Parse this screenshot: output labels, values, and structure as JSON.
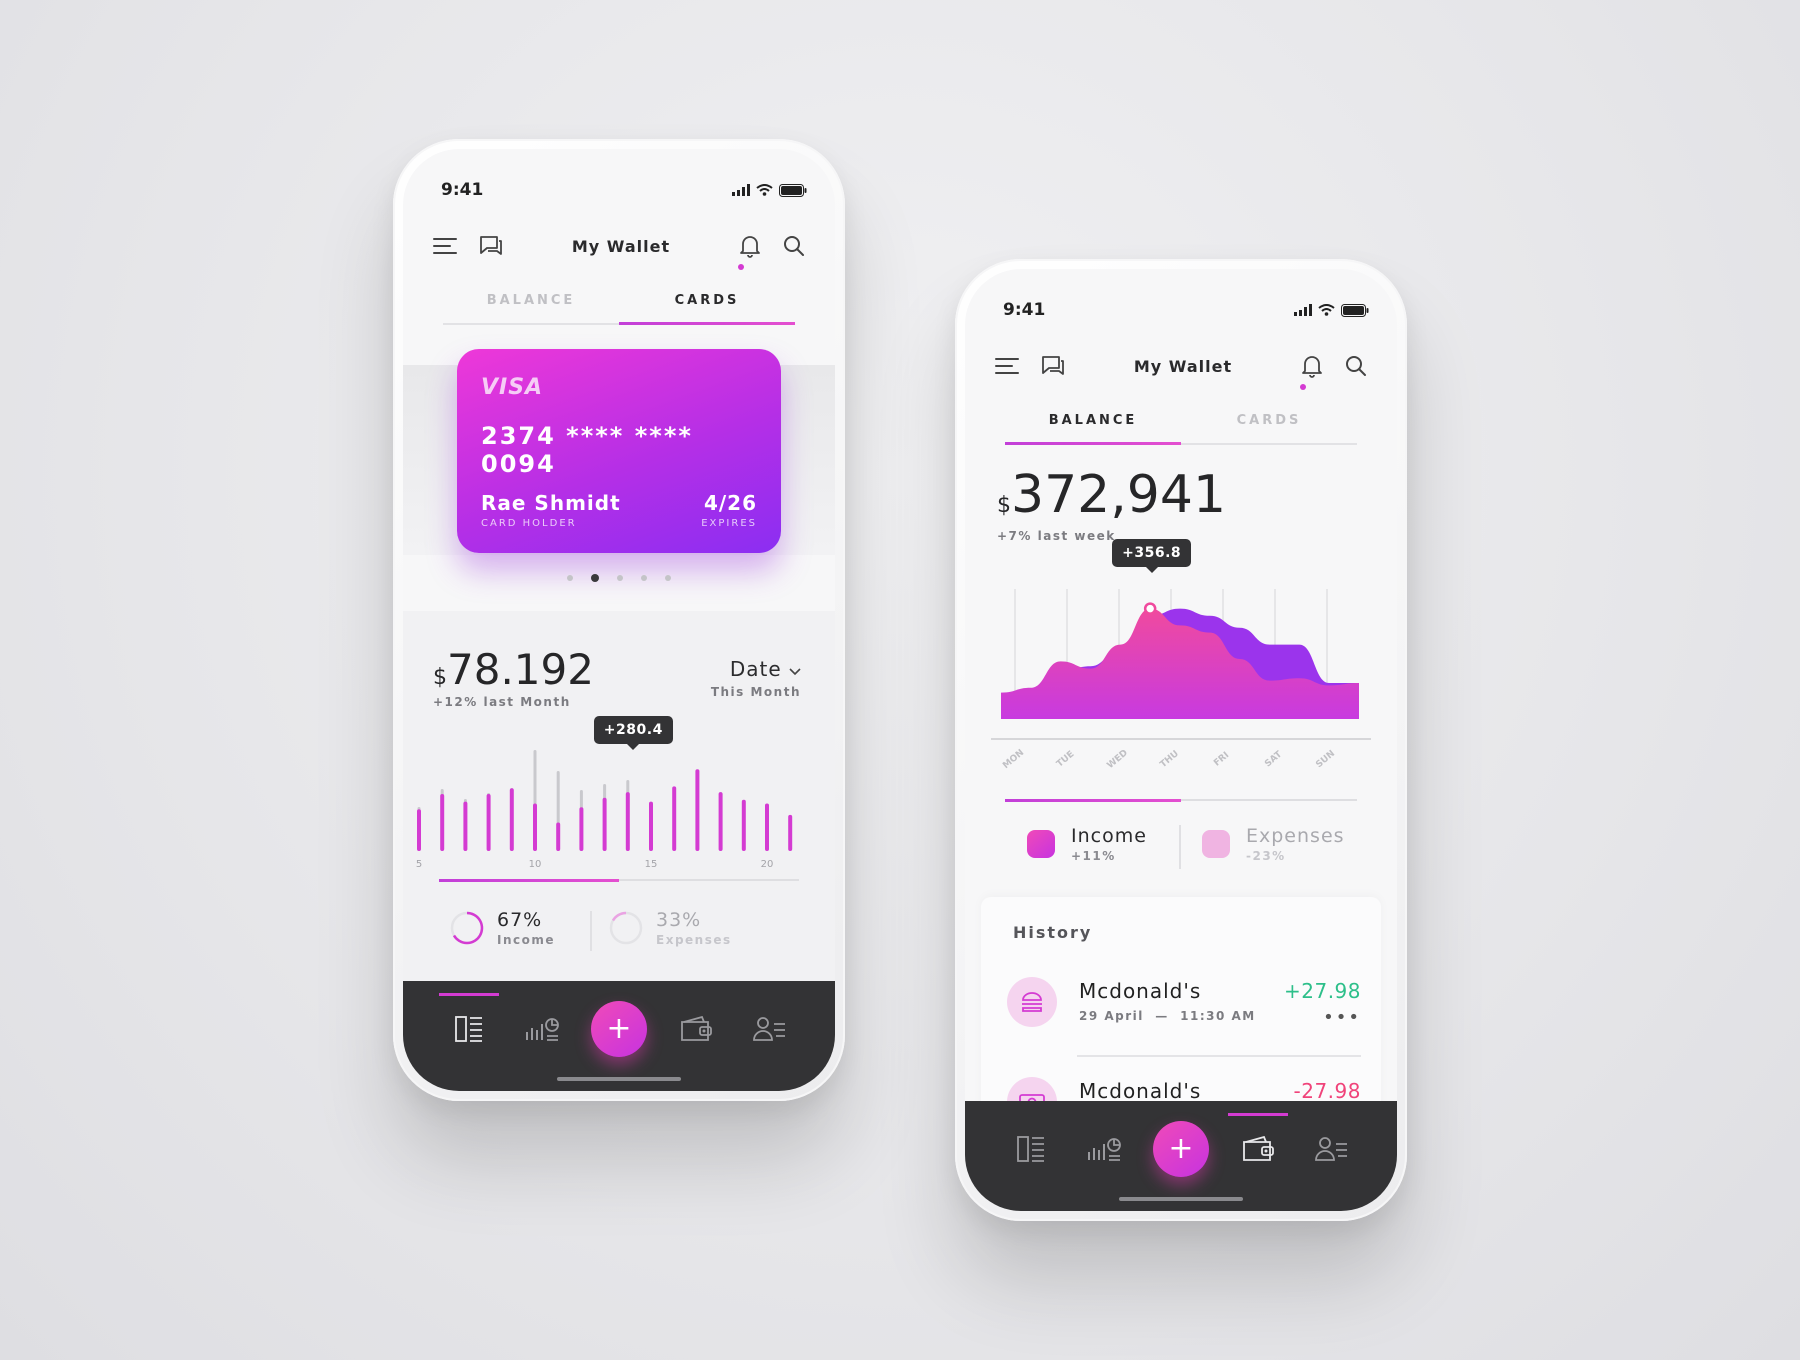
{
  "colors": {
    "accent": "#d43bd2",
    "accent_purple": "#8b2ef2",
    "income_green": "#2dbf8a",
    "expense_red": "#f0437a",
    "nav_bg": "#333335"
  },
  "left_phone": {
    "status_time": "9:41",
    "appbar": {
      "title": "My Wallet",
      "icons": [
        "menu-icon",
        "chat-icon",
        "bell-icon",
        "search-icon"
      ]
    },
    "tabs": [
      {
        "label": "BALANCE",
        "active": false
      },
      {
        "label": "CARDS",
        "active": true
      }
    ],
    "card": {
      "brand": "VISA",
      "number": "2374 **** **** 0094",
      "holder_name": "Rae Shmidt",
      "holder_label": "CARD HOLDER",
      "expiry": "4/26",
      "expiry_label": "EXPIRES",
      "pager_count": 5,
      "pager_active": 1
    },
    "summary": {
      "currency": "$",
      "amount": "78.192",
      "change": "+12% last Month",
      "date_label": "Date",
      "date_sub": "This Month"
    },
    "chart_data": {
      "type": "bar",
      "x": [
        5,
        6,
        7,
        8,
        9,
        10,
        11,
        12,
        13,
        14,
        15,
        16,
        17,
        18,
        19,
        20,
        21
      ],
      "tick_labels": [
        "5",
        "10",
        "15",
        "20"
      ],
      "series": [
        {
          "values": [
            22,
            30,
            26,
            30,
            33,
            25,
            15,
            23,
            28,
            31,
            26,
            34,
            43,
            31,
            27,
            25,
            19
          ]
        },
        {
          "values": [
            44,
            62,
            52,
            58,
            63,
            101,
            80,
            61,
            67,
            71,
            0,
            0,
            0,
            59,
            0,
            0,
            0
          ]
        }
      ],
      "tooltip": "+280.4",
      "tooltip_x": 14
    },
    "split": {
      "income_pct": "67%",
      "income_label": "Income",
      "income_fraction": 0.5,
      "expenses_pct": "33%",
      "expenses_label": "Expenses"
    },
    "nav": {
      "icons": [
        "dashboard-icon",
        "stats-icon",
        "add-icon",
        "wallet-icon",
        "profile-icon"
      ],
      "active": "dashboard",
      "fab_label": "+"
    }
  },
  "right_phone": {
    "status_time": "9:41",
    "appbar": {
      "title": "My Wallet"
    },
    "tabs": [
      {
        "label": "BALANCE",
        "active": true
      },
      {
        "label": "CARDS",
        "active": false
      }
    ],
    "summary": {
      "currency": "$",
      "amount": "372,941",
      "change": "+7% last week"
    },
    "chart_data": {
      "type": "area",
      "categories": [
        "MON",
        "TUE",
        "WED",
        "THU",
        "FRI",
        "SAT",
        "SUN"
      ],
      "series": [
        {
          "values": [
            0.22,
            0.26,
            0.48,
            0.42,
            0.62,
            0.92,
            0.78,
            0.72,
            0.5,
            0.32,
            0.34,
            0.28,
            0.3
          ]
        },
        {
          "values": [
            0.2,
            0.24,
            0.4,
            0.44,
            0.58,
            0.86,
            0.92,
            0.86,
            0.76,
            0.62,
            0.62,
            0.3,
            0.3
          ]
        }
      ],
      "tooltip": "+356.8",
      "tooltip_index": 5
    },
    "legend": {
      "income_label": "Income",
      "income_change": "+11%",
      "expenses_label": "Expenses",
      "expenses_change": "-23%",
      "income_fraction": 0.5
    },
    "history": {
      "title": "History",
      "items": [
        {
          "name": "Mcdonald's",
          "date": "29 April",
          "time": "11:30 AM",
          "amount": "+27.98",
          "icon": "burger-icon"
        },
        {
          "name": "Mcdonald's",
          "amount": "-27.98",
          "icon": "cash-icon"
        }
      ]
    },
    "nav": {
      "active": "wallet",
      "fab_label": "+"
    }
  }
}
